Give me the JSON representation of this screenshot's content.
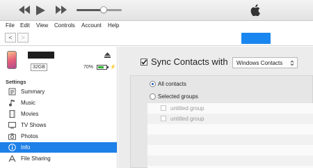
{
  "player": {
    "controls": [
      "rewind-icon",
      "play-icon",
      "fast-forward-icon"
    ],
    "volume": 0.6,
    "logo": "apple-logo-icon"
  },
  "menu": [
    "File",
    "Edit",
    "View",
    "Controls",
    "Account",
    "Help"
  ],
  "nav": {
    "back": "<",
    "forward": ">"
  },
  "device": {
    "capacity": "32GB",
    "battery_percent": "70%",
    "battery_level": 0.7,
    "battery_color": "#2fb12f"
  },
  "sidebar": {
    "section_title": "Settings",
    "items": [
      {
        "label": "Summary",
        "icon": "summary-icon"
      },
      {
        "label": "Music",
        "icon": "music-note-icon"
      },
      {
        "label": "Movies",
        "icon": "film-icon"
      },
      {
        "label": "TV Shows",
        "icon": "tv-icon"
      },
      {
        "label": "Photos",
        "icon": "camera-icon"
      },
      {
        "label": "Info",
        "icon": "info-icon",
        "selected": true
      },
      {
        "label": "File Sharing",
        "icon": "app-store-icon"
      }
    ]
  },
  "main": {
    "sync_label": "Sync Contacts with",
    "sync_checked": true,
    "source_value": "Windows Contacts",
    "all_contacts_label": "All contacts",
    "selected_groups_label": "Selected groups",
    "groups": [
      "untitled group",
      "untitled group"
    ]
  },
  "colors": {
    "accent": "#1e80e8",
    "button_blue": "#1a86f0",
    "panel_bg": "#ececec"
  }
}
